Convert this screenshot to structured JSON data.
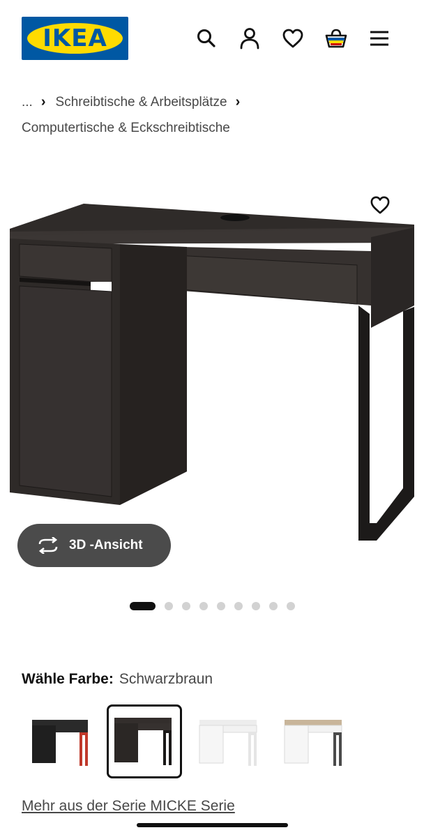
{
  "header": {
    "logo_text": "IKEA",
    "icons": [
      "search-icon",
      "user-icon",
      "heart-icon",
      "shopping-bag-icon",
      "menu-icon"
    ],
    "colors": {
      "logo_blue": "#0058a3",
      "logo_yellow": "#ffdb00"
    }
  },
  "breadcrumb": {
    "ellipsis": "...",
    "level1": "Schreibtische & Arbeitsplätze",
    "level2": "Computertische & Eckschreibtische"
  },
  "product": {
    "view_3d_label": "3D -Ansicht",
    "gallery": {
      "total": 9,
      "active": 1
    }
  },
  "color_choice": {
    "label": "Wähle Farbe:",
    "value": "Schwarzbraun",
    "options": [
      "anthracite-red",
      "black-brown",
      "white",
      "white-oak-effect"
    ],
    "selected_index": 1
  },
  "series_link": "Mehr aus der Serie MICKE Serie"
}
